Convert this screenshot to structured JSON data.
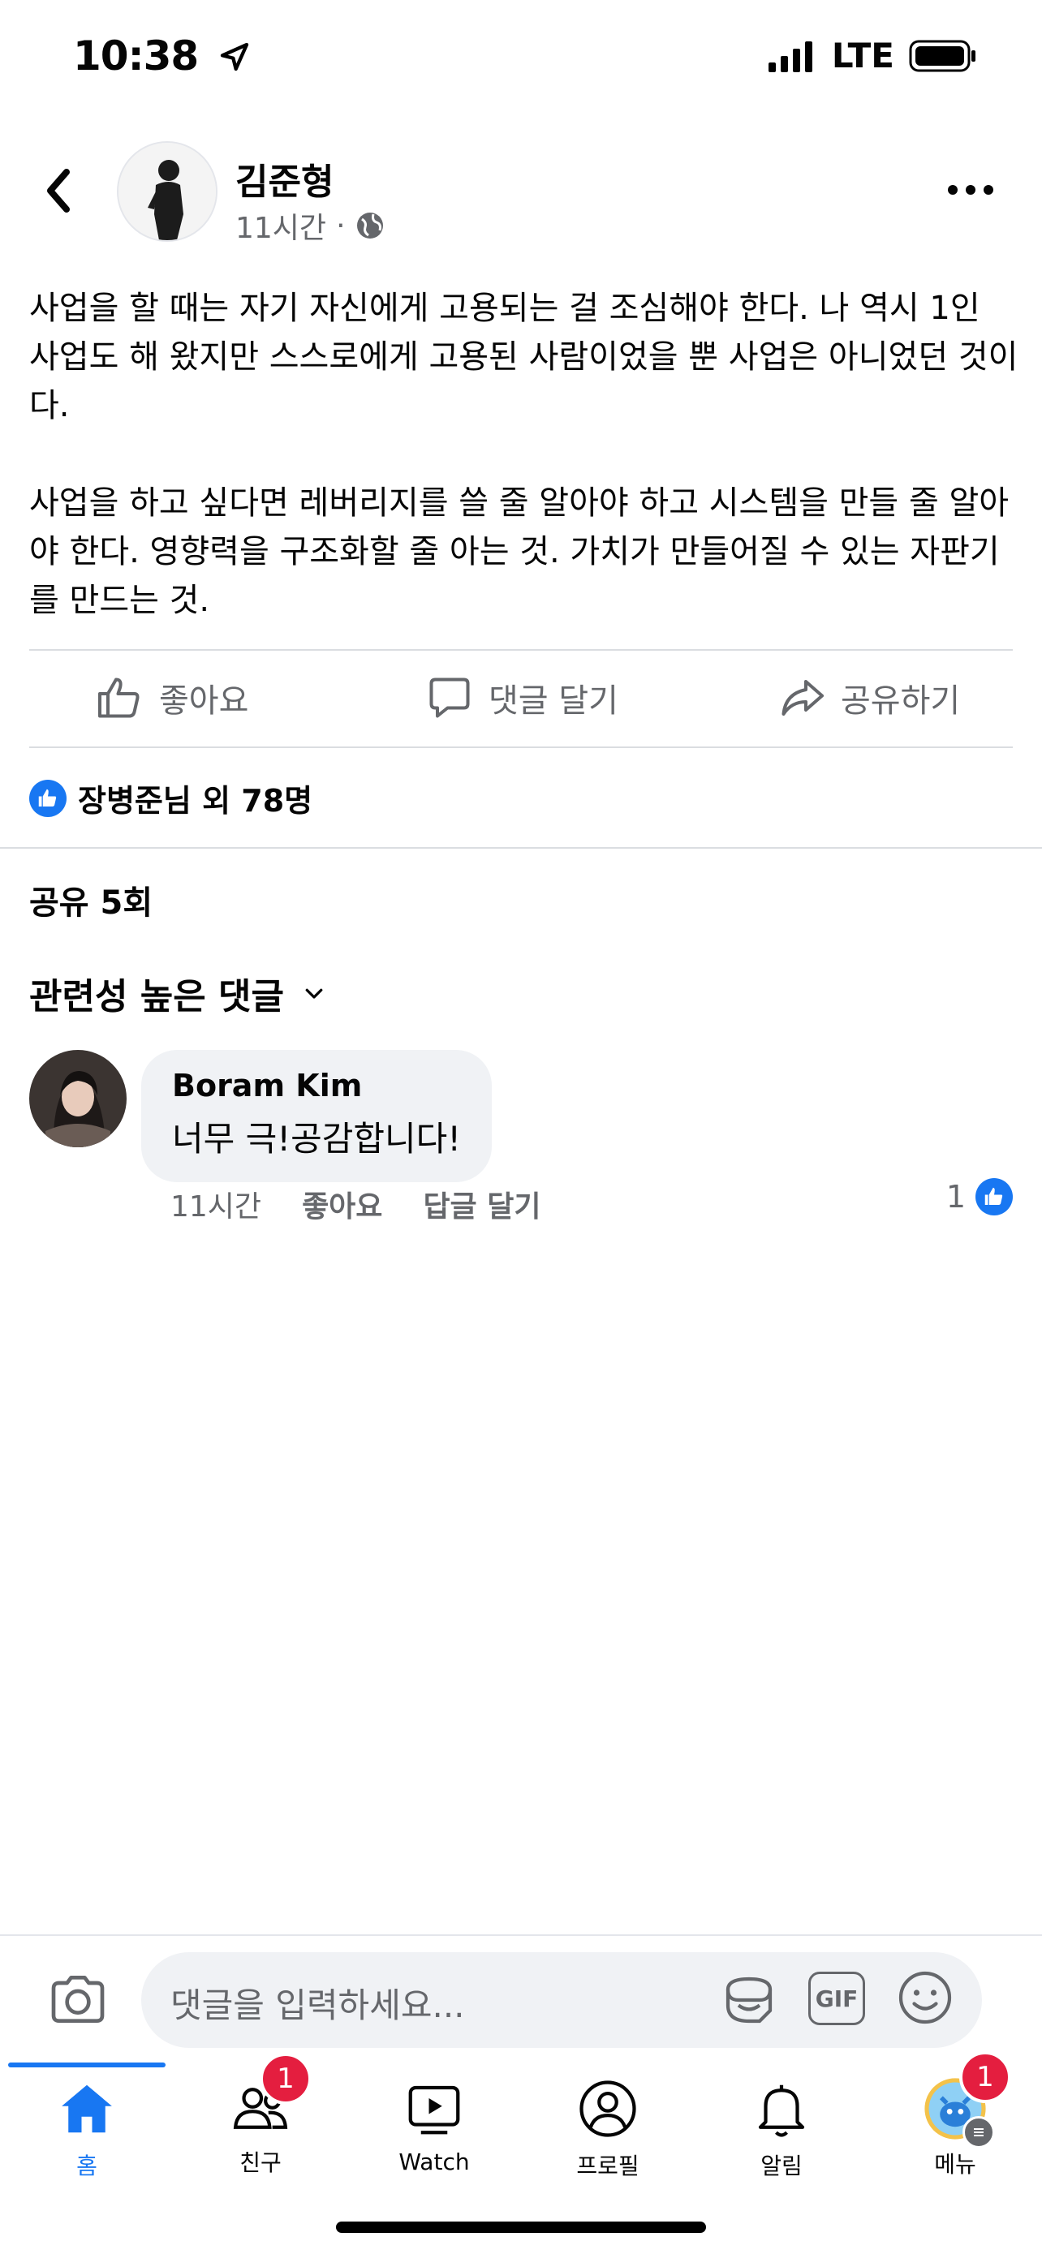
{
  "status": {
    "time": "10:38",
    "network": "LTE"
  },
  "post": {
    "author": "김준형",
    "time": "11시간",
    "paragraphs": [
      "사업을 할 때는 자기 자신에게 고용되는 걸 조심해야 한다. 나 역시 1인 사업도 해 왔지만 스스로에게 고용된 사람이었을 뿐 사업은 아니었던 것이다.",
      "사업을 하고 싶다면 레버리지를 쓸 줄 알아야 하고 시스템을 만들 줄 알아야 한다. 영향력을 구조화할 줄 아는 것. 가치가 만들어질 수 있는 자판기를 만드는 것."
    ],
    "actions": {
      "like": "좋아요",
      "comment": "댓글 달기",
      "share": "공유하기"
    },
    "reactions_text": "장병준님 외 78명",
    "shares_text": "공유 5회"
  },
  "comments_section": {
    "sort_label": "관련성 높은 댓글"
  },
  "comment": {
    "name": "Boram Kim",
    "text": "너무 극!공감합니다!",
    "time": "11시간",
    "like": "좋아요",
    "reply": "답글 달기",
    "like_count": "1"
  },
  "composer": {
    "placeholder": "댓글을 입력하세요...",
    "gif": "GIF"
  },
  "tabs": [
    {
      "label": "홈",
      "icon": "home-icon",
      "active": true
    },
    {
      "label": "친구",
      "icon": "friends-icon",
      "badge": "1"
    },
    {
      "label": "Watch",
      "icon": "watch-icon"
    },
    {
      "label": "프로필",
      "icon": "profile-icon"
    },
    {
      "label": "알림",
      "icon": "bell-icon"
    },
    {
      "label": "메뉴",
      "icon": "menu-avatar-icon",
      "badge": "1"
    }
  ],
  "colors": {
    "accent": "#1877f2",
    "badge": "#e41e3f",
    "secondary_text": "#65676b",
    "bubble": "#f0f2f5"
  }
}
